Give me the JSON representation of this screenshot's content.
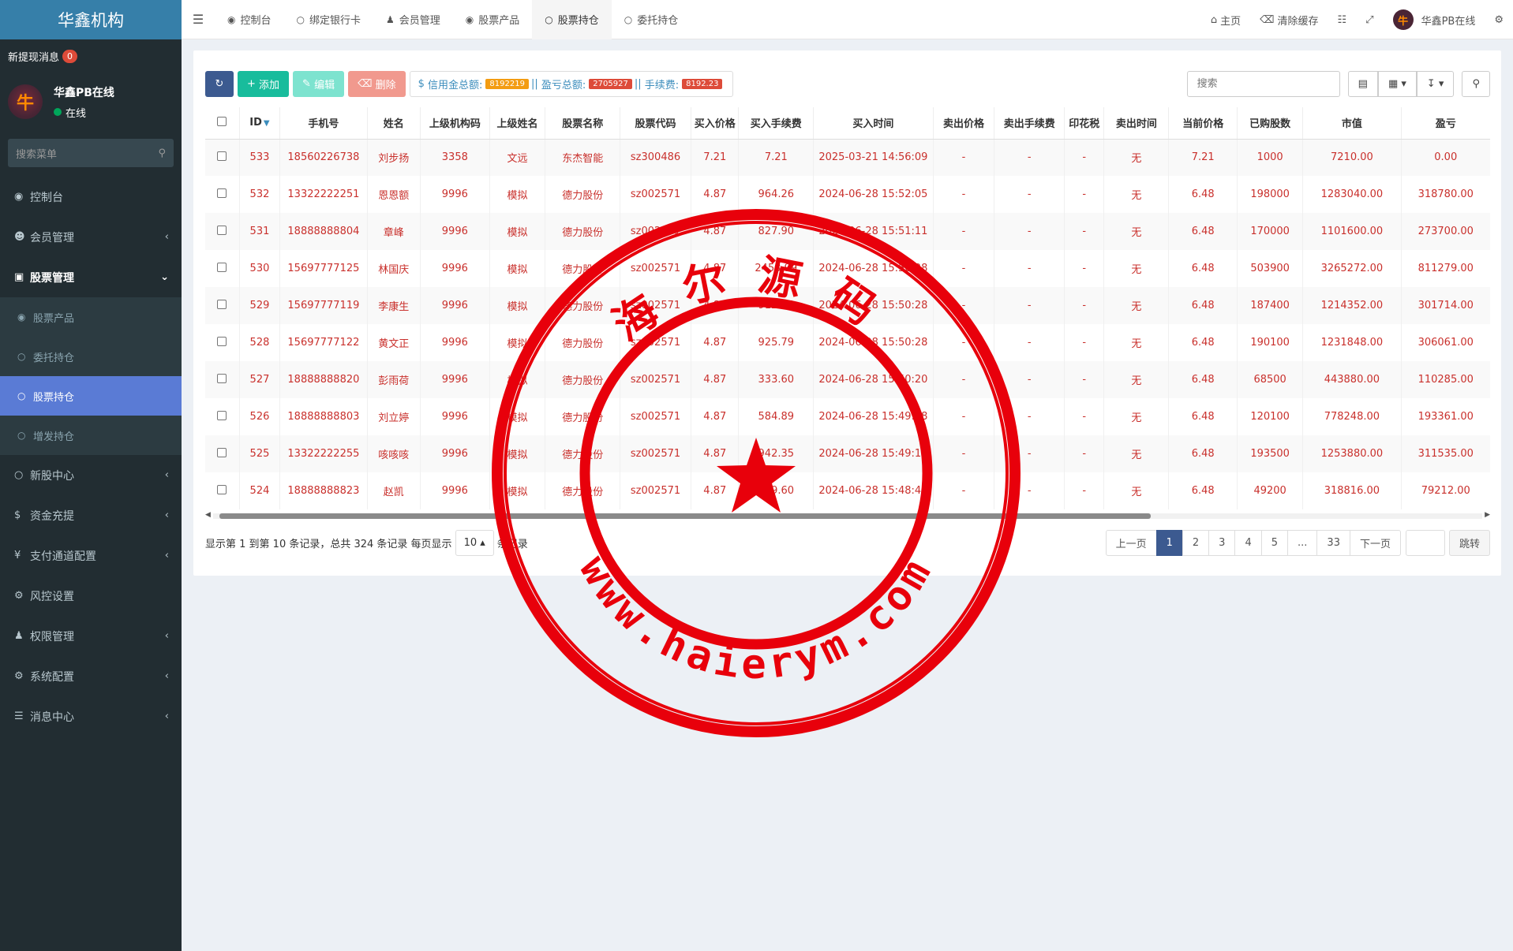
{
  "sidebar": {
    "brand": "华鑫机构",
    "new_withdraw_label": "新提现消息",
    "new_withdraw_count": "0",
    "user_name": "华鑫PB在线",
    "user_status": "在线",
    "search_placeholder": "搜索菜单",
    "menu": [
      {
        "label": "控制台",
        "icon": "dashboard-icon"
      },
      {
        "label": "会员管理",
        "icon": "user-circle-icon"
      },
      {
        "label": "股票管理",
        "icon": "bank-icon"
      },
      {
        "label": "新股中心",
        "icon": "circle-icon"
      },
      {
        "label": "资金充提",
        "icon": "dollar-icon"
      },
      {
        "label": "支付通道配置",
        "icon": "yen-icon"
      },
      {
        "label": "风控设置",
        "icon": "gear-icon"
      },
      {
        "label": "权限管理",
        "icon": "users-icon"
      },
      {
        "label": "系统配置",
        "icon": "cog-icon"
      },
      {
        "label": "消息中心",
        "icon": "list-icon"
      }
    ],
    "submenu": [
      "股票产品",
      "委托持仓",
      "股票持仓",
      "增发持仓"
    ]
  },
  "topbar": {
    "tabs": [
      {
        "label": "控制台",
        "icon": "dashboard-icon"
      },
      {
        "label": "绑定银行卡",
        "icon": "circle-icon"
      },
      {
        "label": "会员管理",
        "icon": "user-icon"
      },
      {
        "label": "股票产品",
        "icon": "dot-circle-icon"
      },
      {
        "label": "股票持仓",
        "icon": "circle-icon"
      },
      {
        "label": "委托持仓",
        "icon": "circle-icon"
      }
    ],
    "home": "主页",
    "clear_cache": "清除缓存",
    "user": "华鑫PB在线"
  },
  "toolbar": {
    "add": "添加",
    "edit": "编辑",
    "delete": "删除",
    "credit_label": "信用金总额:",
    "credit_value": "8192219",
    "pnl_label": "盈亏总额:",
    "pnl_value": "2705927",
    "fee_label": "手续费:",
    "fee_value": "8192.23",
    "search_placeholder": "搜索"
  },
  "table": {
    "headers": [
      "ID",
      "手机号",
      "姓名",
      "上级机构码",
      "上级姓名",
      "股票名称",
      "股票代码",
      "买入价格",
      "买入手续费",
      "买入时间",
      "卖出价格",
      "卖出手续费",
      "印花税",
      "卖出时间",
      "当前价格",
      "已购股数",
      "市值",
      "盈亏"
    ],
    "rows": [
      [
        "533",
        "18560226738",
        "刘步扬",
        "3358",
        "文远",
        "东杰智能",
        "sz300486",
        "7.21",
        "7.21",
        "2025-03-21 14:56:09",
        "-",
        "-",
        "-",
        "无",
        "7.21",
        "1000",
        "7210.00",
        "0.00"
      ],
      [
        "532",
        "13322222251",
        "恩恩额",
        "9996",
        "模拟",
        "德力股份",
        "sz002571",
        "4.87",
        "964.26",
        "2024-06-28 15:52:05",
        "-",
        "-",
        "-",
        "无",
        "6.48",
        "198000",
        "1283040.00",
        "318780.00"
      ],
      [
        "531",
        "18888888804",
        "章峰",
        "9996",
        "模拟",
        "德力股份",
        "sz002571",
        "4.87",
        "827.90",
        "2024-06-28 15:51:11",
        "-",
        "-",
        "-",
        "无",
        "6.48",
        "170000",
        "1101600.00",
        "273700.00"
      ],
      [
        "530",
        "15697777125",
        "林国庆",
        "9996",
        "模拟",
        "德力股份",
        "sz002571",
        "4.87",
        "2453.99",
        "2024-06-28 15:50:28",
        "-",
        "-",
        "-",
        "无",
        "6.48",
        "503900",
        "3265272.00",
        "811279.00"
      ],
      [
        "529",
        "15697777119",
        "李康生",
        "9996",
        "模拟",
        "德力股份",
        "sz002571",
        "4.87",
        "912.84",
        "2024-06-28 15:50:28",
        "-",
        "-",
        "-",
        "无",
        "6.48",
        "187400",
        "1214352.00",
        "301714.00"
      ],
      [
        "528",
        "15697777122",
        "黄文正",
        "9996",
        "模拟",
        "德力股份",
        "sz002571",
        "4.87",
        "925.79",
        "2024-06-28 15:50:28",
        "-",
        "-",
        "-",
        "无",
        "6.48",
        "190100",
        "1231848.00",
        "306061.00"
      ],
      [
        "527",
        "18888888820",
        "彭雨荷",
        "9996",
        "模拟",
        "德力股份",
        "sz002571",
        "4.87",
        "333.60",
        "2024-06-28 15:50:20",
        "-",
        "-",
        "-",
        "无",
        "6.48",
        "68500",
        "443880.00",
        "110285.00"
      ],
      [
        "526",
        "18888888803",
        "刘立婷",
        "9996",
        "模拟",
        "德力股份",
        "sz002571",
        "4.87",
        "584.89",
        "2024-06-28 15:49:38",
        "-",
        "-",
        "-",
        "无",
        "6.48",
        "120100",
        "778248.00",
        "193361.00"
      ],
      [
        "525",
        "13322222255",
        "咳咳咳",
        "9996",
        "模拟",
        "德力股份",
        "sz002571",
        "4.87",
        "942.35",
        "2024-06-28 15:49:13",
        "-",
        "-",
        "-",
        "无",
        "6.48",
        "193500",
        "1253880.00",
        "311535.00"
      ],
      [
        "524",
        "18888888823",
        "赵凯",
        "9996",
        "模拟",
        "德力股份",
        "sz002571",
        "4.87",
        "239.60",
        "2024-06-28 15:48:41",
        "-",
        "-",
        "-",
        "无",
        "6.48",
        "49200",
        "318816.00",
        "79212.00"
      ]
    ]
  },
  "footer": {
    "summary": "显示第 1 到第 10 条记录，总共 324 条记录 每页显示",
    "page_size": "10",
    "suffix": "条记录",
    "prev": "上一页",
    "pages": [
      "1",
      "2",
      "3",
      "4",
      "5",
      "...",
      "33"
    ],
    "next": "下一页",
    "jump": "跳转"
  },
  "watermark": {
    "top_text": "海尔源码",
    "bottom_text": "www.haierym.com",
    "color": "#e8000b"
  }
}
